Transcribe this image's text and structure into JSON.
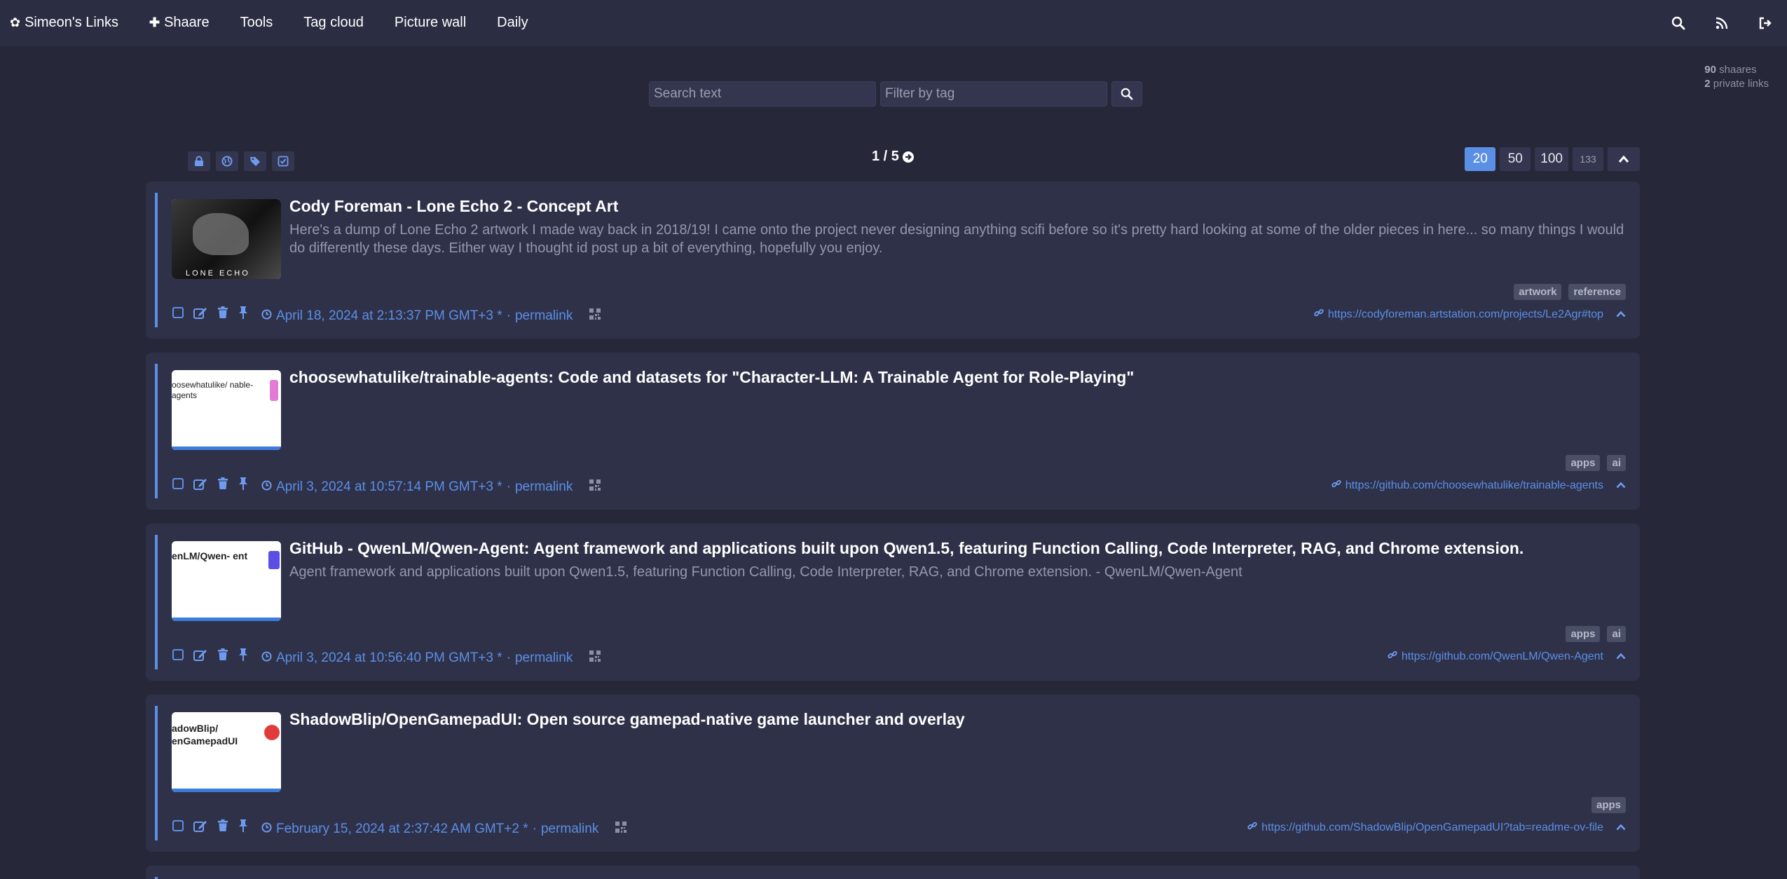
{
  "nav": {
    "brand": "Simeon's Links",
    "items": [
      "Shaare",
      "Tools",
      "Tag cloud",
      "Picture wall",
      "Daily"
    ]
  },
  "search": {
    "text_placeholder": "Search text",
    "tag_placeholder": "Filter by tag"
  },
  "counts": {
    "shaares_num": "90",
    "shaares_label": "shaares",
    "private_num": "2",
    "private_label": "private links"
  },
  "pagination": {
    "current": "1 / 5",
    "per_page": [
      "20",
      "50",
      "100"
    ],
    "total_small": "133",
    "active_per_page": "20"
  },
  "links": [
    {
      "title": "Cody Foreman - Lone Echo 2 - Concept Art",
      "description": "Here's a dump of Lone Echo 2 artwork I made way back in 2018/19! I came onto the project never designing anything scifi before so it's pretty hard looking at some of the older pieces in here... so many things I would do differently these days. Either way I thought id post up a bit of everything, hopefully you enjoy.",
      "tags": [
        "artwork",
        "reference"
      ],
      "date": "April 18, 2024 at 2:13:37 PM GMT+3 *",
      "permalink": "permalink",
      "url": "https://codyforeman.artstation.com/projects/Le2Agr#top",
      "thumb_text": "LONE ECHO"
    },
    {
      "title": "choosewhatulike/trainable-agents: Code and datasets for \"Character-LLM: A Trainable Agent for Role-Playing\"",
      "description": "",
      "tags": [
        "apps",
        "ai"
      ],
      "date": "April 3, 2024 at 10:57:14 PM GMT+3 *",
      "permalink": "permalink",
      "url": "https://github.com/choosewhatulike/trainable-agents",
      "thumb_text": "oosewhatulike/ nable-agents"
    },
    {
      "title": "GitHub - QwenLM/Qwen-Agent: Agent framework and applications built upon Qwen1.5, featuring Function Calling, Code Interpreter, RAG, and Chrome extension.",
      "description": "Agent framework and applications built upon Qwen1.5, featuring Function Calling, Code Interpreter, RAG, and Chrome extension. - QwenLM/Qwen-Agent",
      "tags": [
        "apps",
        "ai"
      ],
      "date": "April 3, 2024 at 10:56:40 PM GMT+3 *",
      "permalink": "permalink",
      "url": "https://github.com/QwenLM/Qwen-Agent",
      "thumb_text": "enLM/Qwen- ent"
    },
    {
      "title": "ShadowBlip/OpenGamepadUI: Open source gamepad-native game launcher and overlay",
      "description": "",
      "tags": [
        "apps"
      ],
      "date": "February 15, 2024 at 2:37:42 AM GMT+2 *",
      "permalink": "permalink",
      "url": "https://github.com/ShadowBlip/OpenGamepadUI?tab=readme-ov-file",
      "thumb_text": "adowBlip/ enGamepadUI"
    }
  ],
  "colors": {
    "background": "#262839",
    "card": "#2f3149",
    "accent": "#5b8fe6",
    "navbar": "#2b2d42"
  }
}
